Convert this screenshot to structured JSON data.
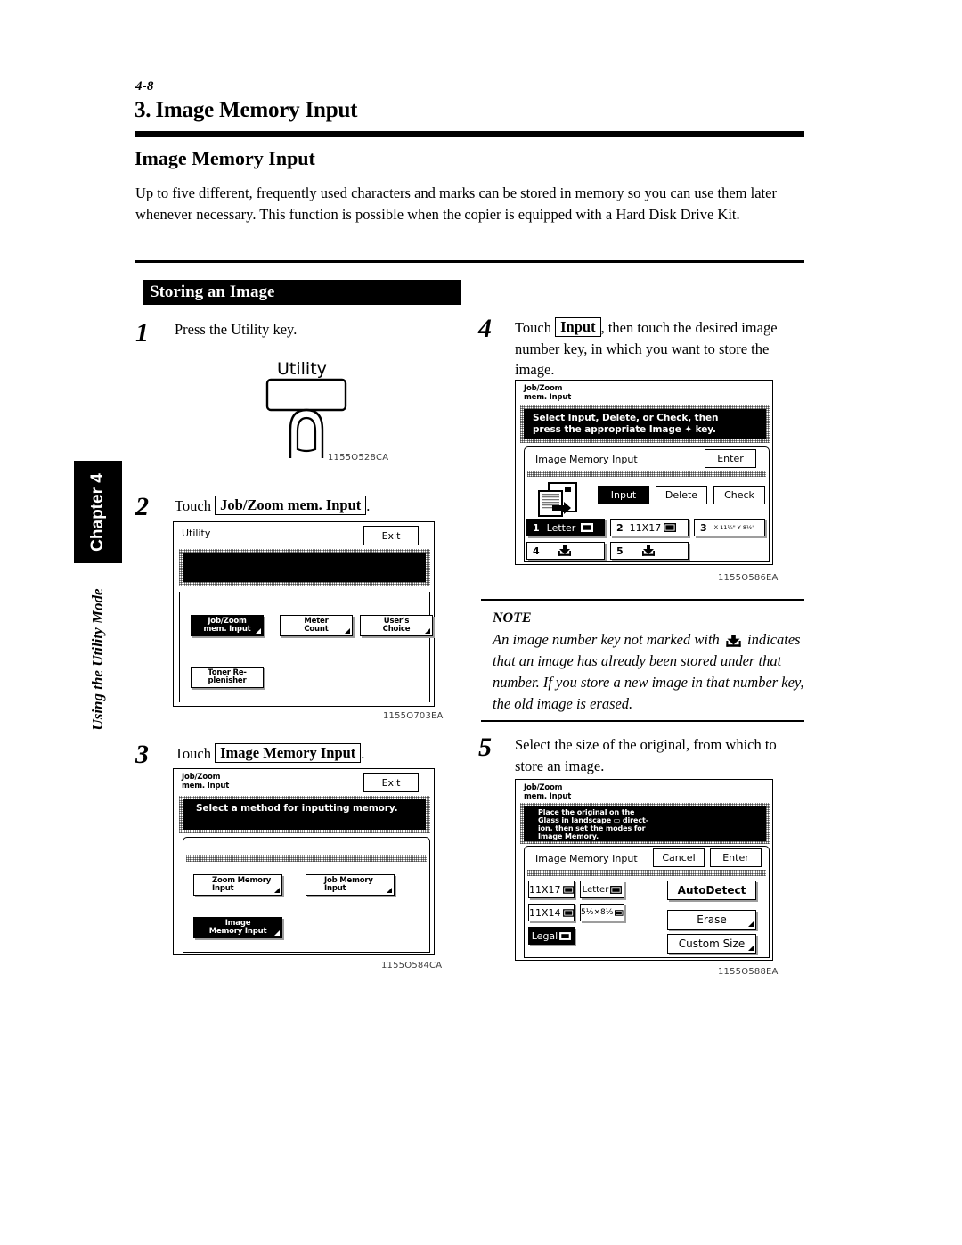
{
  "page": {
    "folio": "4-8",
    "chapter_number": "3.",
    "chapter_title": "Image Memory Input",
    "section_title": "Image Memory Input",
    "intro": "Up to five different, frequently used characters and marks can be stored in memory so you can use them later whenever necessary.  This function is possible when the copier is equipped with a Hard Disk Drive Kit.",
    "banner": "Storing an Image"
  },
  "side_tab": {
    "chapter_label": "Chapter 4",
    "chapter_subtitle": "Using the Utility Mode"
  },
  "steps": {
    "one": {
      "number": "1",
      "text": "Press the Utility key.",
      "utility_key_label": "Utility",
      "figure_id": "1155O528CA"
    },
    "two": {
      "number": "2",
      "text_before": "Touch",
      "key_label": "Job/Zoom mem. Input",
      "text_after": ".",
      "figure_id": "1155O703EA",
      "panel": {
        "title": "Utility",
        "exit_label": "Exit",
        "buttons": [
          {
            "label_line1": "Job/Zoom",
            "label_line2": "mem. Input",
            "selected": true
          },
          {
            "label_line1": "Meter",
            "label_line2": "Count",
            "selected": false
          },
          {
            "label_line1": "User's",
            "label_line2": "Choice",
            "selected": false
          },
          {
            "label_line1": "Toner Re-",
            "label_line2": "plenisher",
            "selected": false
          }
        ]
      }
    },
    "three": {
      "number": "3",
      "text_before": "Touch",
      "key_label": "Image Memory Input",
      "text_after": ".",
      "figure_id": "1155O584CA",
      "panel": {
        "title_line1": "Job/Zoom",
        "title_line2": "mem. Input",
        "exit_label": "Exit",
        "message": "Select a method for inputting memory.",
        "buttons": [
          {
            "label_line1": "Zoom Memory",
            "label_line2": "Input",
            "selected": false
          },
          {
            "label_line1": "Job Memory",
            "label_line2": "Input",
            "selected": false
          },
          {
            "label_line1": "Image",
            "label_line2": "Memory Input",
            "selected": true
          }
        ]
      }
    },
    "four": {
      "number": "4",
      "text_before": "Touch",
      "key_label": "Input",
      "text_after": ", then touch the desired image number key, in which you want to store the image.",
      "figure_id": "1155O586EA",
      "panel": {
        "title_line1": "Job/Zoom",
        "title_line2": "mem. Input",
        "message_line1": "Select Input, Delete, or Check, then",
        "message_line2": "press the appropriate Image ✦ key.",
        "inner_title": "Image Memory Input",
        "enter_label": "Enter",
        "mode_buttons": [
          {
            "label": "Input",
            "selected": true
          },
          {
            "label": "Delete",
            "selected": false
          },
          {
            "label": "Check",
            "selected": false
          }
        ],
        "image_keys": [
          {
            "number": "1",
            "label": "Letter",
            "icon": "landscape-sheet-icon",
            "selected": true
          },
          {
            "number": "2",
            "label": "11X17",
            "icon": "landscape-sheet-icon",
            "selected": false
          },
          {
            "number": "3",
            "label": "X 11¼\"  Y 8½\"",
            "icon": "",
            "selected": false
          },
          {
            "number": "4",
            "label": "",
            "icon": "store-arrow-icon",
            "selected": false
          },
          {
            "number": "5",
            "label": "",
            "icon": "store-arrow-icon",
            "selected": false
          }
        ]
      }
    },
    "five": {
      "number": "5",
      "text": "Select the size of the original, from which to store an image.",
      "figure_id": "1155O588EA",
      "panel": {
        "title_line1": "Job/Zoom",
        "title_line2": "mem. Input",
        "message_line1": "Place the original on the",
        "message_line2": "Glass in landscape ▭ direct-",
        "message_line3": "ion, then set the modes for",
        "message_line4": "Image Memory.",
        "inner_title": "Image Memory Input",
        "cancel_label": "Cancel",
        "enter_label": "Enter",
        "size_keys": [
          {
            "label": "11X17",
            "selected": false
          },
          {
            "label": "Letter",
            "selected": false
          },
          {
            "label": "11X14",
            "selected": false
          },
          {
            "label": "5½×8½",
            "selected": false
          },
          {
            "label": "Legal",
            "selected": true
          }
        ],
        "right_buttons": [
          {
            "label": "AutoDetect",
            "fold": false
          },
          {
            "label": "Erase",
            "fold": true
          },
          {
            "label": "Custom Size",
            "fold": true
          }
        ]
      }
    }
  },
  "note": {
    "heading": "NOTE",
    "line1_a": "An image number key not marked with",
    "line1_b": "",
    "body": "indicates that an image has already been stored under that number.  If you store a new image in that number key, the old image is erased."
  }
}
